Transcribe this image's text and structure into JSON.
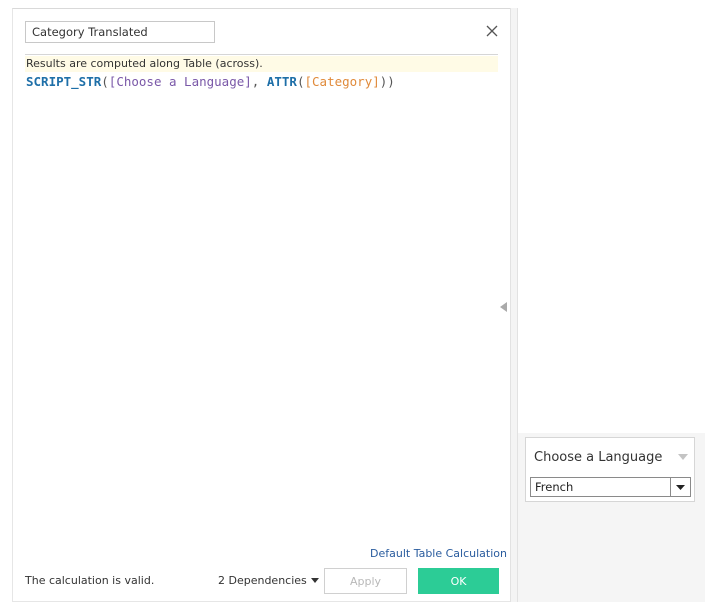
{
  "dialog": {
    "calc_name": "Category Translated",
    "info_text": "Results are computed along Table (across).",
    "formula": {
      "function": "SCRIPT_STR",
      "open": "(",
      "parameter": "[Choose a Language]",
      "separator": ", ",
      "agg_function": "ATTR",
      "agg_open": "(",
      "field": "[Category]",
      "close": "))"
    },
    "default_table_calc_label": "Default Table Calculation",
    "status_text": "The calculation is valid.",
    "dependencies_label": "2 Dependencies",
    "apply_label": "Apply",
    "ok_label": "OK",
    "icons": {
      "close": "close-icon",
      "dependencies_caret": "caret-down-icon",
      "splitter": "triangle-left-icon"
    }
  },
  "parameter_control": {
    "title": "Choose a Language",
    "selected_value": "French",
    "icons": {
      "menu": "caret-down-icon",
      "dropdown": "caret-down-icon"
    }
  },
  "colors": {
    "ok_button": "#2ccc96",
    "function_keyword": "#1e6fa8",
    "parameter_ref": "#7a58a8",
    "field_ref": "#e08a3a",
    "link": "#2a5c9e",
    "info_bar": "#fffbe6"
  }
}
